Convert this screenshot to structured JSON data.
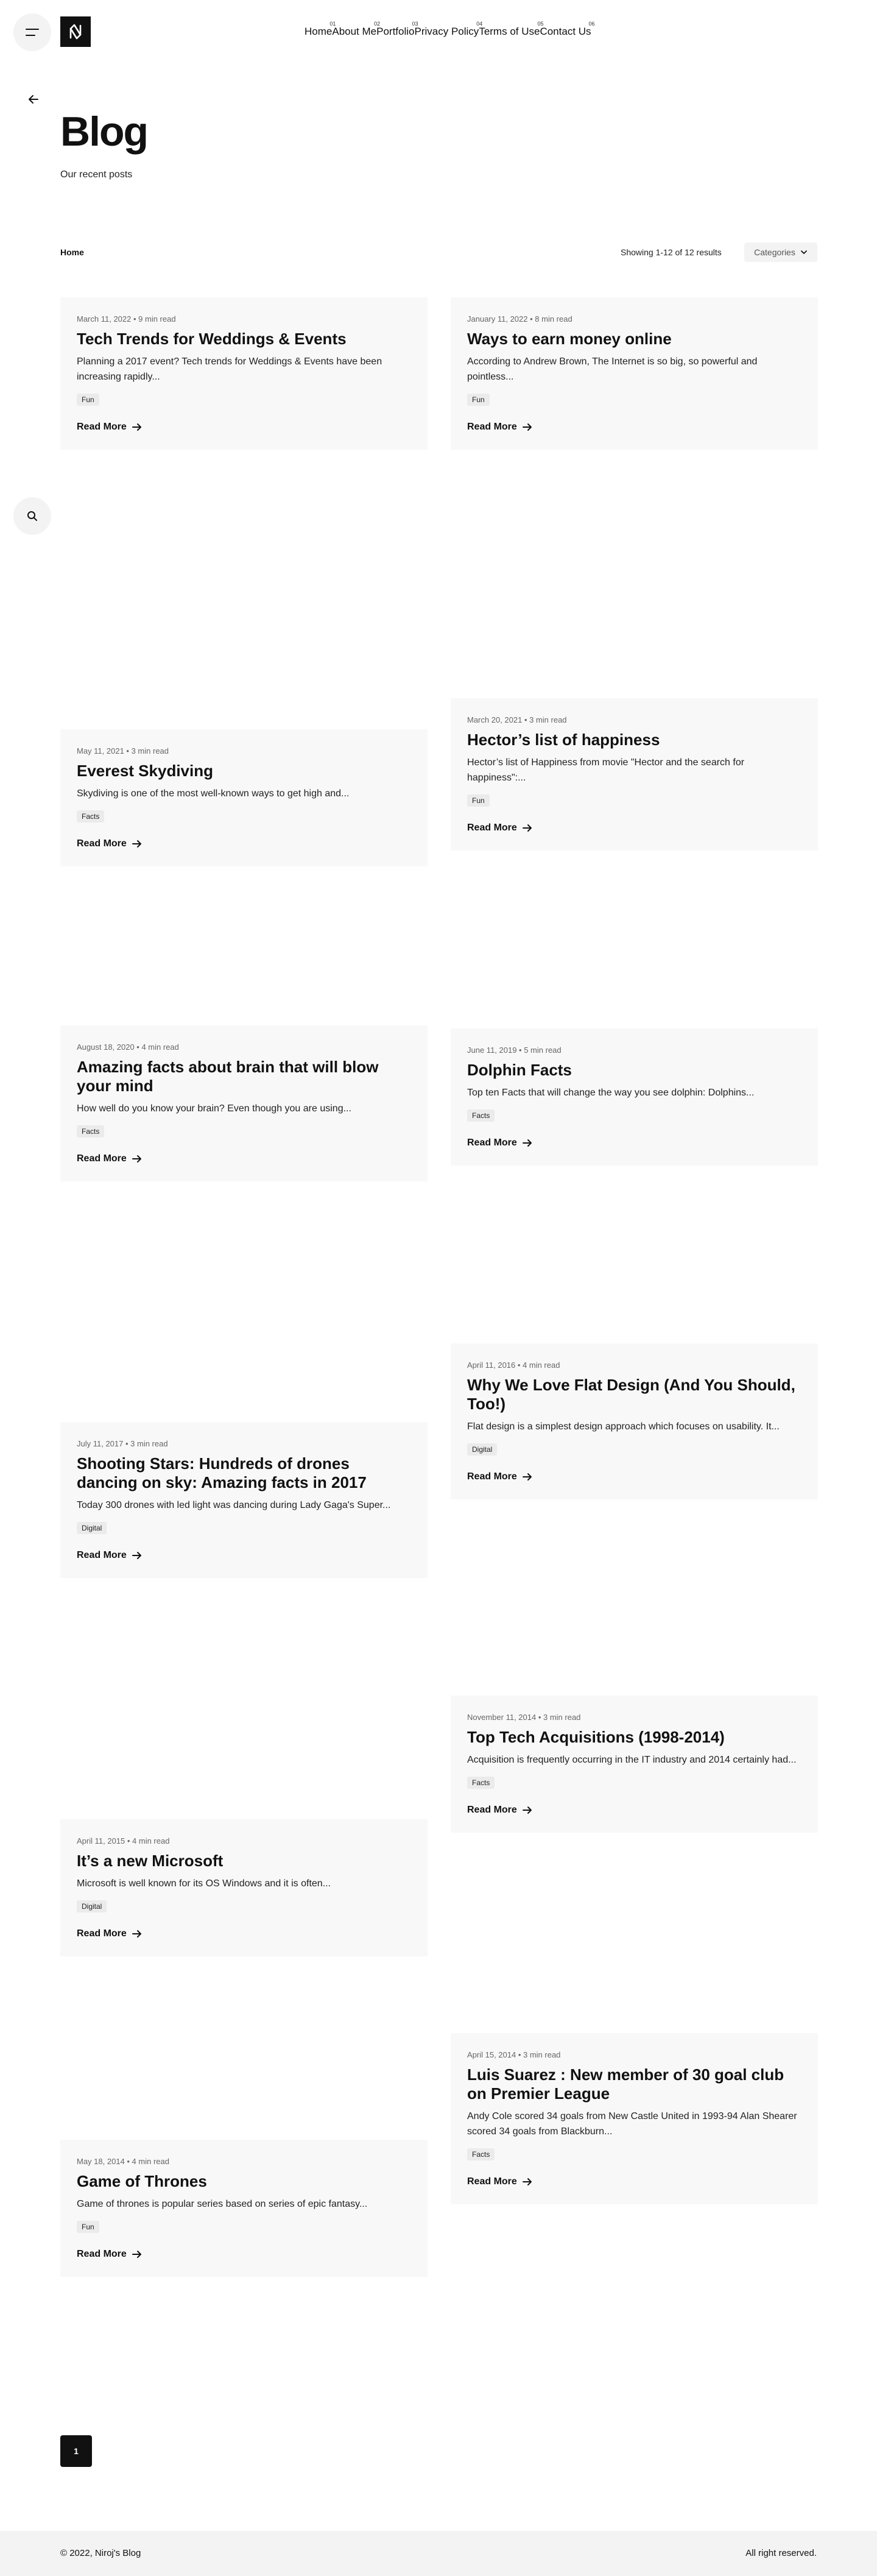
{
  "header": {
    "menu_icon": "hamburger-icon",
    "logo_icon": "n-logo-icon",
    "nav": [
      {
        "num": "01",
        "label": "Home"
      },
      {
        "num": "02",
        "label": "About Me"
      },
      {
        "num": "03",
        "label": "Portfolio"
      },
      {
        "num": "04",
        "label": "Privacy Policy"
      },
      {
        "num": "05",
        "label": "Terms of Use"
      },
      {
        "num": "06",
        "label": "Contact Us"
      }
    ]
  },
  "hero": {
    "back_icon": "arrow-left-icon",
    "title": "Blog",
    "subtitle": "Our recent posts"
  },
  "toolbar": {
    "breadcrumb": "Home",
    "results": "Showing 1-12 of 12 results",
    "categories_label": "Categories",
    "categories_icon": "chevron-down-icon"
  },
  "search_icon": "search-icon",
  "read_more_label": "Read More",
  "posts": [
    {
      "meta": "March 11, 2022 • 9 min read",
      "title": "Tech Trends for Weddings & Events",
      "excerpt": "Planning a 2017 event? Tech trends for Weddings & Events have been increasing rapidly...",
      "tag": "Fun"
    },
    {
      "meta": "January 11, 2022 • 8 min read",
      "title": "Ways to earn money online",
      "excerpt": "According to Andrew Brown, The Internet is so big, so powerful and pointless...",
      "tag": "Fun"
    },
    {
      "meta": "May 11, 2021 • 3 min read",
      "title": "Everest Skydiving",
      "excerpt": "Skydiving is one of the most well-known ways to get high and...",
      "tag": "Facts"
    },
    {
      "meta": "March 20, 2021 • 3 min read",
      "title": "Hector’s list of happiness",
      "excerpt": "Hector’s list of Happiness from movie \"Hector and the search for happiness\":...",
      "tag": "Fun"
    },
    {
      "meta": "August 18, 2020 • 4 min read",
      "title": "Amazing facts about brain that will blow your mind",
      "excerpt": " How well do you know your brain? Even though you are using...",
      "tag": "Facts"
    },
    {
      "meta": "June 11, 2019 • 5 min read",
      "title": "Dolphin Facts",
      "excerpt": "Top ten Facts that will change the way you see dolphin: Dolphins...",
      "tag": "Facts"
    },
    {
      "meta": "July 11, 2017 • 3 min read",
      "title": "Shooting Stars: Hundreds of drones dancing on sky: Amazing facts in 2017",
      "excerpt": "Today 300 drones with led light was dancing during Lady Gaga's Super...",
      "tag": "Digital"
    },
    {
      "meta": "April 11, 2016 • 4 min read",
      "title": "Why We Love Flat Design (And You Should, Too!)",
      "excerpt": "Flat design is a simplest design approach which focuses on usability. It...",
      "tag": "Digital"
    },
    {
      "meta": "April 11, 2015 • 4 min read",
      "title": "It’s a new Microsoft",
      "excerpt": "Microsoft is well known for its OS Windows and it is often...",
      "tag": "Digital"
    },
    {
      "meta": "November 11, 2014 • 3 min read",
      "title": "Top Tech Acquisitions (1998-2014)",
      "excerpt": "Acquisition is frequently occurring in the IT industry and 2014 certainly had...",
      "tag": "Facts"
    },
    {
      "meta": "May 18, 2014 • 4 min read",
      "title": "Game of Thrones",
      "excerpt": "Game of thrones is popular series based on series of epic fantasy...",
      "tag": "Fun"
    },
    {
      "meta": "April 15, 2014 • 3 min read",
      "title": "Luis Suarez : New member of 30 goal club on Premier League",
      "excerpt": "Andy Cole scored 34 goals from New Castle United in 1993-94 Alan Shearer scored 34 goals from Blackburn...",
      "tag": "Facts"
    }
  ],
  "pagination": {
    "current": "1"
  },
  "footer": {
    "copyright": "© 2022, Niroj's Blog",
    "rights": "All right reserved."
  }
}
